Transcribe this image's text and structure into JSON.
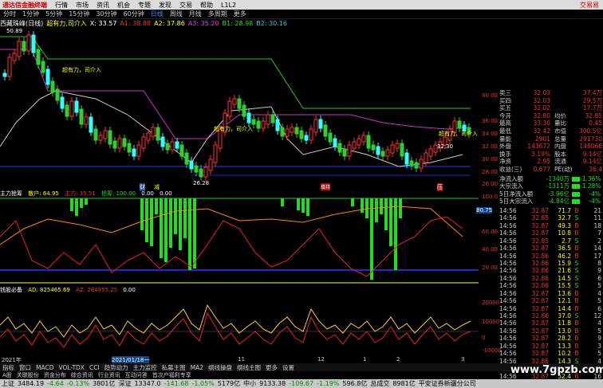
{
  "menubar": {
    "logo": "通达信金融终端",
    "items": [
      "行情",
      "市场",
      "资讯",
      "机会",
      "专题",
      "发现",
      "交易",
      "帮助",
      "L1L2"
    ],
    "right": "交易易"
  },
  "periods": [
    "分时",
    "1分钟",
    "5分钟",
    "15分钟",
    "30分钟",
    "60分钟",
    "日线",
    "周线",
    "月线",
    "多周期",
    "更多"
  ],
  "chart_head": {
    "name": "西藏珠峰(日线)",
    "item1": "超有力,司介入",
    "item2": "X: 33.57",
    "item3": "A1: 38.88",
    "item4": "A2: 37.86",
    "item5": "A3: 35.20",
    "item6": "B1: 28.98",
    "item7": "B2: 30.16"
  },
  "annotations": {
    "top_label": "50.89",
    "low_label": "26.28",
    "power1": "超有力，司介入",
    "power2": "超有力，司介入",
    "power3": "超有力，司介入",
    "mid_label": "32.30",
    "mid_label2": "32.30",
    "tag1": "财",
    "tag2": "减",
    "tag3": "增持",
    "tag4": "压"
  },
  "price_axis": [
    "40.00",
    "36.00",
    "34.00",
    "32.00",
    "30.00",
    "28.00",
    "26.00"
  ],
  "ind1": {
    "title": "主力抢筹",
    "v1": "散户: 64.95",
    "v2": "主力: 35.51",
    "v3": "抢筹: 100.00",
    "v4": "0.00",
    "v5": "0.00",
    "axis": [
      "100.0",
      "80.75",
      "60.00",
      "40.00",
      "20.00"
    ]
  },
  "ind2": {
    "title": "钱股必备",
    "v1": "AD: 825465.69",
    "v2": "AZ: 264955.25",
    "v3": "0.00",
    "axis": [
      "20000",
      "10000",
      "0",
      "-10000"
    ]
  },
  "xaxis": [
    "2021年",
    "2021/01/18一",
    "11",
    "12",
    "1",
    "2",
    "3"
  ],
  "quote": [
    {
      "l": "卖三",
      "v": "32.03",
      "l2": "",
      "v2": "37.4万"
    },
    {
      "l": "买四",
      "v": "32.03",
      "l2": "",
      "v2": "29.5万"
    },
    {
      "l": "买五",
      "v": "32.02",
      "l2": "",
      "v2": "17.7万"
    },
    {
      "l": "今开",
      "v": "32.80",
      "l2": "均价",
      "v2": "32.85"
    },
    {
      "l": "最高",
      "v": "33.30",
      "l2": "量比",
      "v2": "0.45"
    },
    {
      "l": "最低",
      "v": "32.42",
      "l2": "市值",
      "v2": "300.5亿"
    },
    {
      "l": "量能",
      "v": "2901",
      "l2": "总量",
      "v2": "291730"
    },
    {
      "l": "外盘",
      "v": "143672",
      "l2": "内盘",
      "v2": "148066"
    },
    {
      "l": "换手",
      "v": "3.19%",
      "l2": "股本",
      "v2": "9.14亿"
    },
    {
      "l": "净资",
      "v": "2.95",
      "l2": "流通",
      "v2": "9.14亿"
    },
    {
      "l": "收益(三)",
      "v": "0.677",
      "l2": "PE(动)",
      "v2": "36.4"
    }
  ],
  "flows": [
    {
      "l": "净流入额",
      "v": "-1340万",
      "p": "-1.36%"
    },
    {
      "l": "大宗流入",
      "v": "-1311万",
      "p": "-1.28%"
    },
    {
      "l": "5日净流入额",
      "v": "-3.96亿",
      "p": "-4%"
    },
    {
      "l": "5日大宗流入",
      "v": "-4.84亿",
      "p": "-4%"
    }
  ],
  "ticks": [
    {
      "t": "14:56",
      "p": "32.87",
      "v": "71.7",
      "d": "B",
      "n": "21"
    },
    {
      "t": "14:56",
      "p": "32.85",
      "v": "32.7",
      "d": "S",
      "n": "11"
    },
    {
      "t": "14:56",
      "p": "32.87",
      "v": "49.3",
      "d": "B",
      "n": "18"
    },
    {
      "t": "14:56",
      "p": "32.87",
      "v": "10.8",
      "d": "B",
      "n": "7"
    },
    {
      "t": "14:56",
      "p": "32.85",
      "v": "2.7",
      "d": "S",
      "n": "2"
    },
    {
      "t": "14:56",
      "p": "32.87",
      "v": "36.5",
      "d": "B",
      "n": "14"
    },
    {
      "t": "14:56",
      "p": "32.86",
      "v": "46.2",
      "d": "B",
      "n": "17"
    },
    {
      "t": "14:56",
      "p": "32.86",
      "v": "15.9",
      "d": "S",
      "n": "8"
    },
    {
      "t": "14:56",
      "p": "32.86",
      "v": "21.6",
      "d": "S",
      "n": "9"
    },
    {
      "t": "14:56",
      "p": "32.86",
      "v": "14.5",
      "d": "S",
      "n": "6"
    },
    {
      "t": "14:56",
      "p": "32.86",
      "v": "15.5",
      "d": "S",
      "n": "5"
    },
    {
      "t": "14:56",
      "p": "32.87",
      "v": "13.6",
      "d": "B",
      "n": "4"
    },
    {
      "t": "14:56",
      "p": "32.87",
      "v": "12.1",
      "d": "B",
      "n": "5"
    },
    {
      "t": "14:56",
      "p": "32.87",
      "v": "14.4",
      "d": "B",
      "n": "6"
    },
    {
      "t": "14:56",
      "p": "32.86",
      "v": "37.0",
      "d": "S",
      "n": "12"
    },
    {
      "t": "14:56",
      "p": "32.87",
      "v": "11.8",
      "d": "B",
      "n": "4"
    },
    {
      "t": "14:56",
      "p": "32.87",
      "v": "13.0",
      "d": "B",
      "n": "5"
    },
    {
      "t": "14:56",
      "p": "32.87",
      "v": "28.2",
      "d": "B",
      "n": "9"
    },
    {
      "t": "14:56",
      "p": "32.87",
      "v": "13.3",
      "d": "B",
      "n": "3"
    },
    {
      "t": "14:56",
      "p": "32.87",
      "v": "10.2",
      "d": "B",
      "n": "5"
    },
    {
      "t": "14:56",
      "p": "32.86",
      "v": "14.3",
      "d": "S",
      "n": "4"
    },
    {
      "t": "14:56",
      "p": "32.86",
      "v": "20.7",
      "d": "B",
      "n": "6"
    },
    {
      "t": "14:56",
      "p": "32.87",
      "v": "52.4",
      "d": "B",
      "n": "16"
    }
  ],
  "tabs1": [
    "指标",
    "窗口",
    "MACD",
    "VOL-TDX",
    "CCI",
    "趋势动力",
    "主力监控",
    "私募主图",
    "MA2",
    "纲线操盘",
    "纲线主图",
    "更多",
    "设置"
  ],
  "tabs2": [
    "A股",
    "关联股份",
    "资金分布",
    "综合资讯",
    "行业资讯",
    "互动问答",
    "首次户福利专享"
  ],
  "status": [
    {
      "n": "上证",
      "v": "3484.19",
      "c": "-4.64",
      "p": "-0.13%",
      "a": "3801亿"
    },
    {
      "n": "深证",
      "v": "13347.0",
      "c": "-141.68",
      "p": "-1.05%",
      "a": "5179亿"
    },
    {
      "n": "中小",
      "v": "9133.38",
      "c": "-109.67",
      "p": "-1.19%",
      "a": "596.8亿"
    }
  ],
  "status_extra": [
    "总成交",
    "8981亿",
    "平安证券新疆分公司"
  ],
  "watermark": "www.7gpzb.com",
  "right_top_label": "交易易"
}
